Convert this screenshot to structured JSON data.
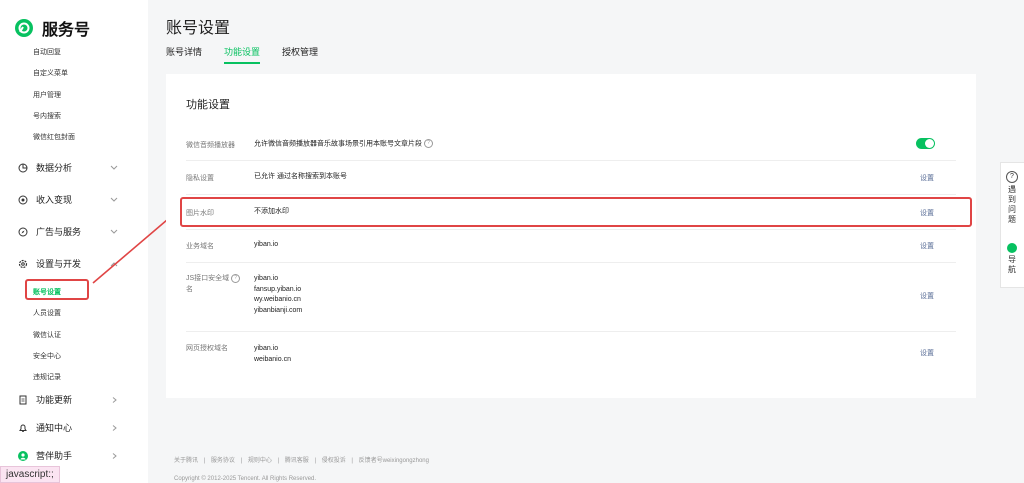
{
  "brand": {
    "name": "服务号"
  },
  "sidebar": {
    "top_items": [
      "自动回复",
      "自定义菜单",
      "用户管理",
      "号内搜索",
      "微信红包封面"
    ],
    "groups": {
      "data": "数据分析",
      "income": "收入变现",
      "ads": "广告与服务",
      "dev": "设置与开发",
      "update": "功能更新",
      "notify": "通知中心",
      "assistant": "营伴助手"
    },
    "dev_items": [
      "账号设置",
      "人员设置",
      "微信认证",
      "安全中心",
      "违规记录"
    ]
  },
  "page": {
    "title": "账号设置",
    "tabs": [
      "账号详情",
      "功能设置",
      "授权管理"
    ],
    "active_tab": "功能设置"
  },
  "card": {
    "title": "功能设置",
    "rows": {
      "audio": {
        "label": "微信音频播放器",
        "value": "允许微信音频播放器音乐故事场景引用本账号文章片段",
        "enabled": true
      },
      "privacy": {
        "label": "隐私设置",
        "value": "已允许 通过名称搜索到本账号",
        "action": "设置"
      },
      "watermark": {
        "label": "图片水印",
        "value": "不添加水印",
        "action": "设置"
      },
      "business_domain": {
        "label": "业务域名",
        "value": "yiban.io",
        "action": "设置"
      },
      "js_domain": {
        "label_line1": "JS接口安全域",
        "label_line2": "名",
        "values": [
          "yiban.io",
          "fansup.yiban.io",
          "wy.weibanio.cn",
          "yibanbianji.com"
        ],
        "action": "设置"
      },
      "oauth_domain": {
        "label": "网页授权域名",
        "values": [
          "yiban.io",
          "weibanio.cn"
        ],
        "action": "设置"
      }
    }
  },
  "footer": {
    "links": [
      "关于腾讯",
      "|",
      "服务协议",
      "|",
      "规则中心",
      "|",
      "腾讯客服",
      "|",
      "侵权投诉",
      "|",
      "反馈者号weixingongzhong"
    ],
    "copyright": "Copyright © 2012-2025 Tencent. All Rights Reserved."
  },
  "float_panel": {
    "help": [
      "遇",
      "到",
      "问",
      "题"
    ],
    "nav": [
      "导",
      "航"
    ]
  },
  "status_bar": {
    "text": "javascript:;"
  },
  "colors": {
    "accent": "#07c160",
    "highlight": "#e04545",
    "link": "#576b95"
  }
}
